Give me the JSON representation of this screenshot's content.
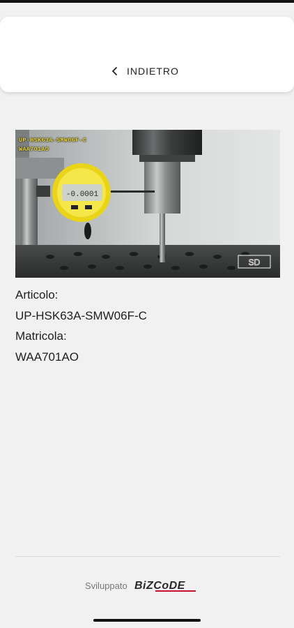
{
  "header": {
    "back_label": "INDIETRO",
    "back_icon": "chevron-left-icon"
  },
  "product_image": {
    "overlay_line1": "UP-HSK63A-SMW06F-C",
    "overlay_line2": "WAA701AO",
    "gauge_reading": "-0.0001"
  },
  "details": {
    "article_label": "Articolo:",
    "article_value": "UP-HSK63A-SMW06F-C",
    "serial_label": "Matricola:",
    "serial_value": "WAA701AO"
  },
  "footer": {
    "developed_by": "Sviluppato",
    "logo_text": "BiZCoDE"
  }
}
